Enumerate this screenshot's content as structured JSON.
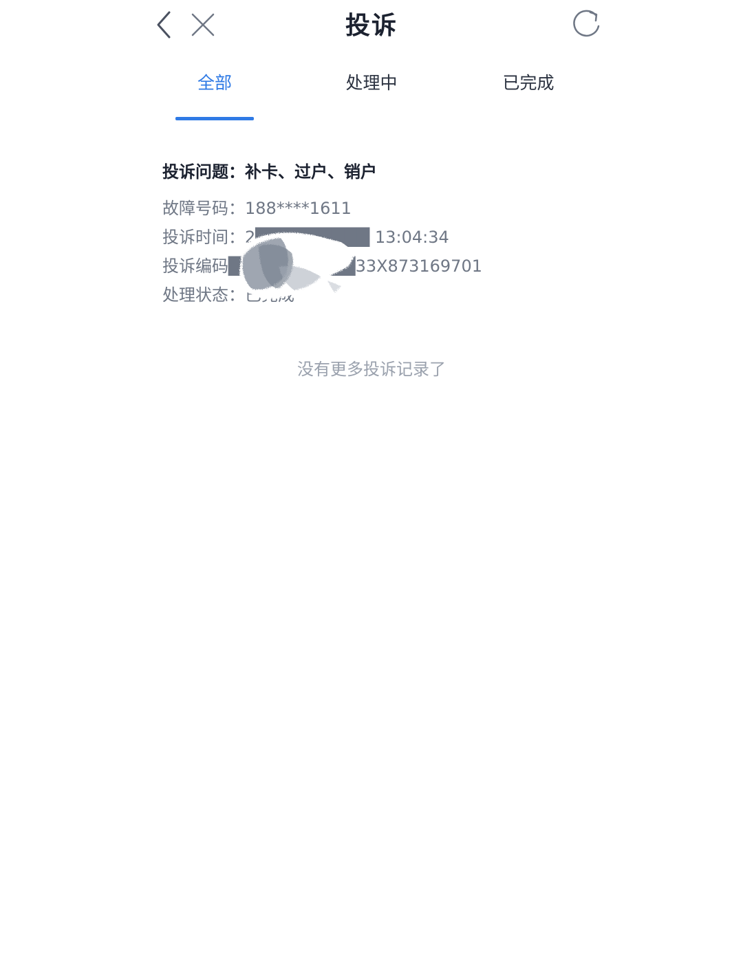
{
  "header": {
    "title": "投诉",
    "back_icon": "chevron-left-icon",
    "close_icon": "close-icon",
    "refresh_icon": "refresh-icon"
  },
  "tabs": [
    {
      "label": "全部",
      "active": true
    },
    {
      "label": "处理中",
      "active": false
    },
    {
      "label": "已完成",
      "active": false
    }
  ],
  "complaint": {
    "title": "投诉问题：补卡、过户、销户",
    "fields": [
      {
        "label": "故障号码：",
        "value": "188****1611"
      },
      {
        "label": "投诉时间：",
        "value": "2█████████ 13:04:34"
      },
      {
        "label": "投诉编码",
        "value": "██████████33X873169701"
      },
      {
        "label": "处理状态：",
        "value": "已完成"
      }
    ]
  },
  "footer_note": "没有更多投诉记录了",
  "colors": {
    "accent": "#2f7ae5",
    "text_primary": "#1c2230",
    "text_secondary": "#6f7785",
    "text_muted": "#9aa1ad"
  }
}
